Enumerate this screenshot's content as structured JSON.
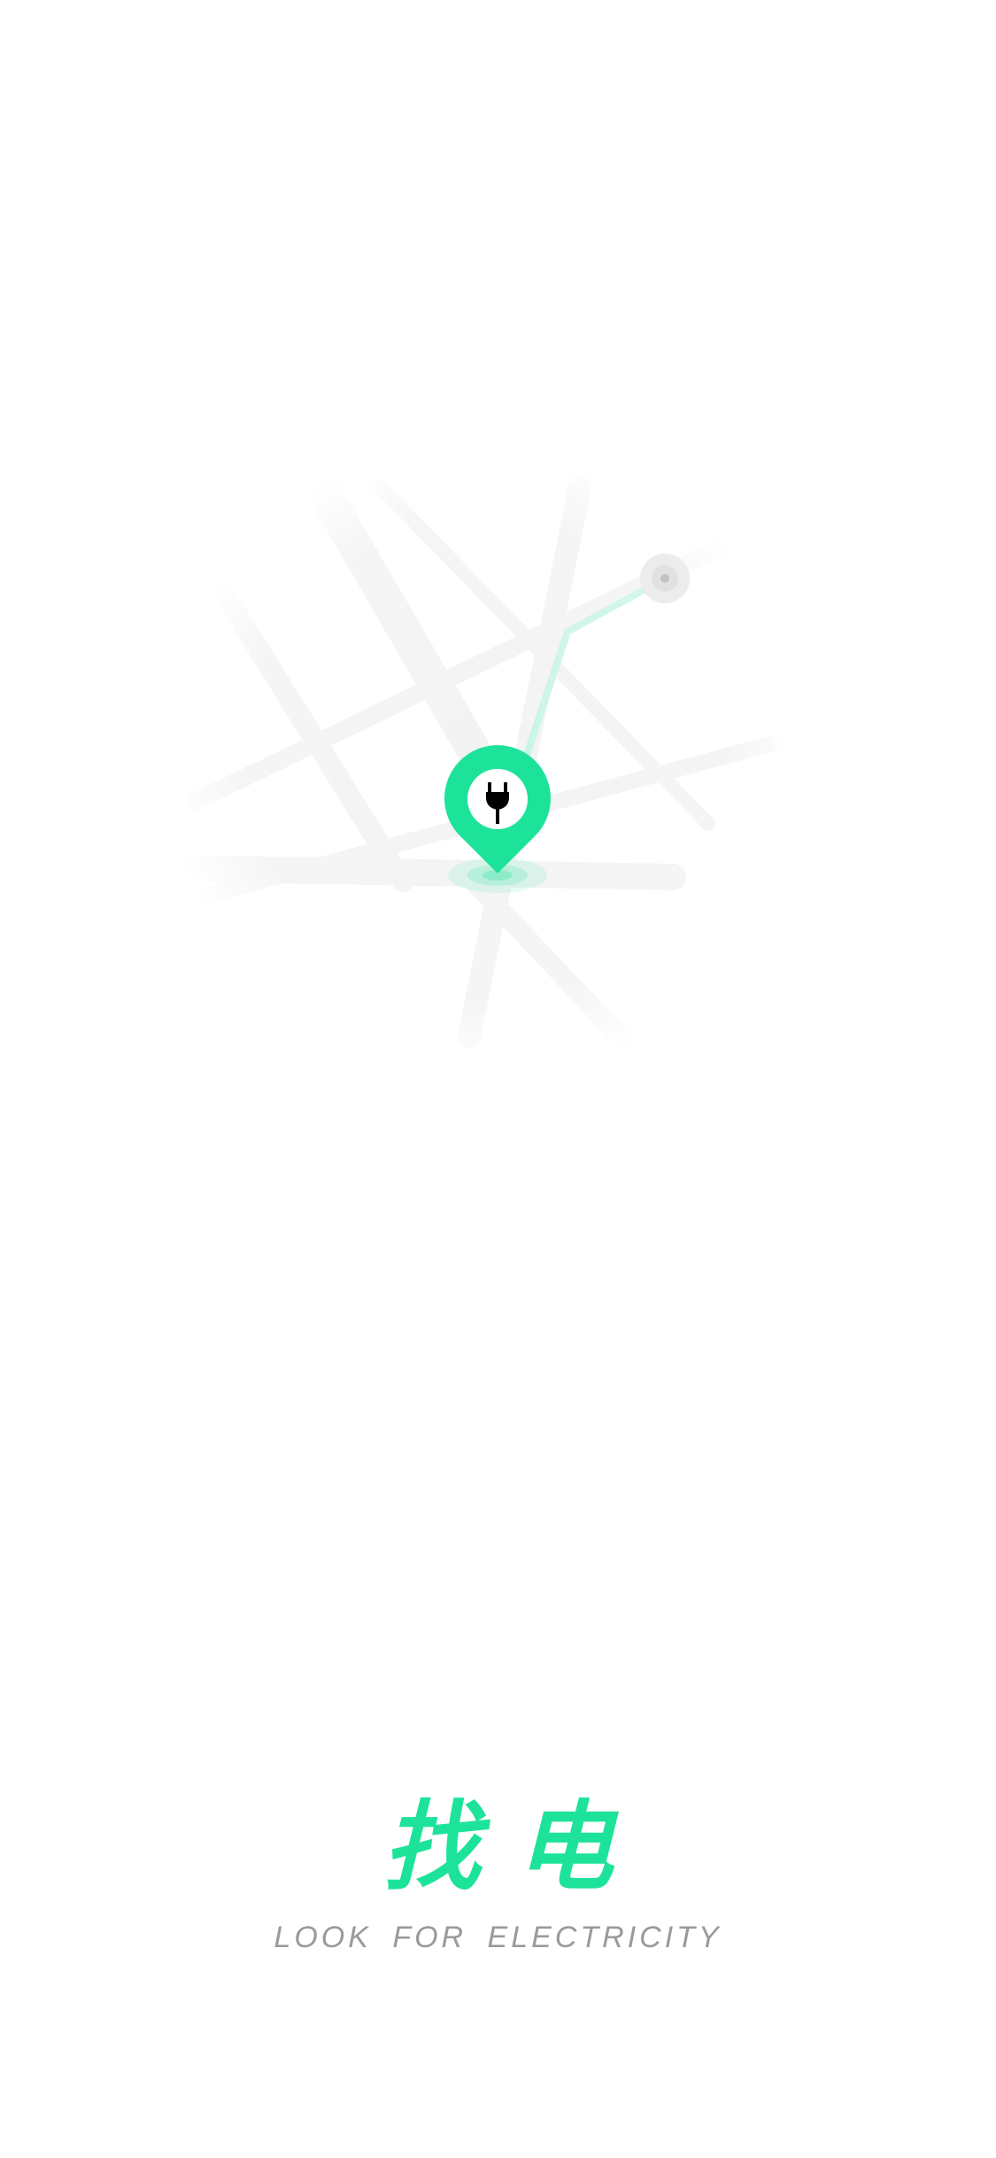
{
  "splash": {
    "app_name": "找电",
    "tagline": "LOOK FOR ELECTRICITY"
  },
  "icons": {
    "pin": "map-pin-icon",
    "plug": "power-plug-icon",
    "origin": "origin-dot-icon"
  },
  "colors": {
    "accent": "#1de39a",
    "route": "#c9f5e4",
    "roads": "#f4f4f4",
    "subtitle": "#9a9a9a",
    "background": "#ffffff"
  }
}
